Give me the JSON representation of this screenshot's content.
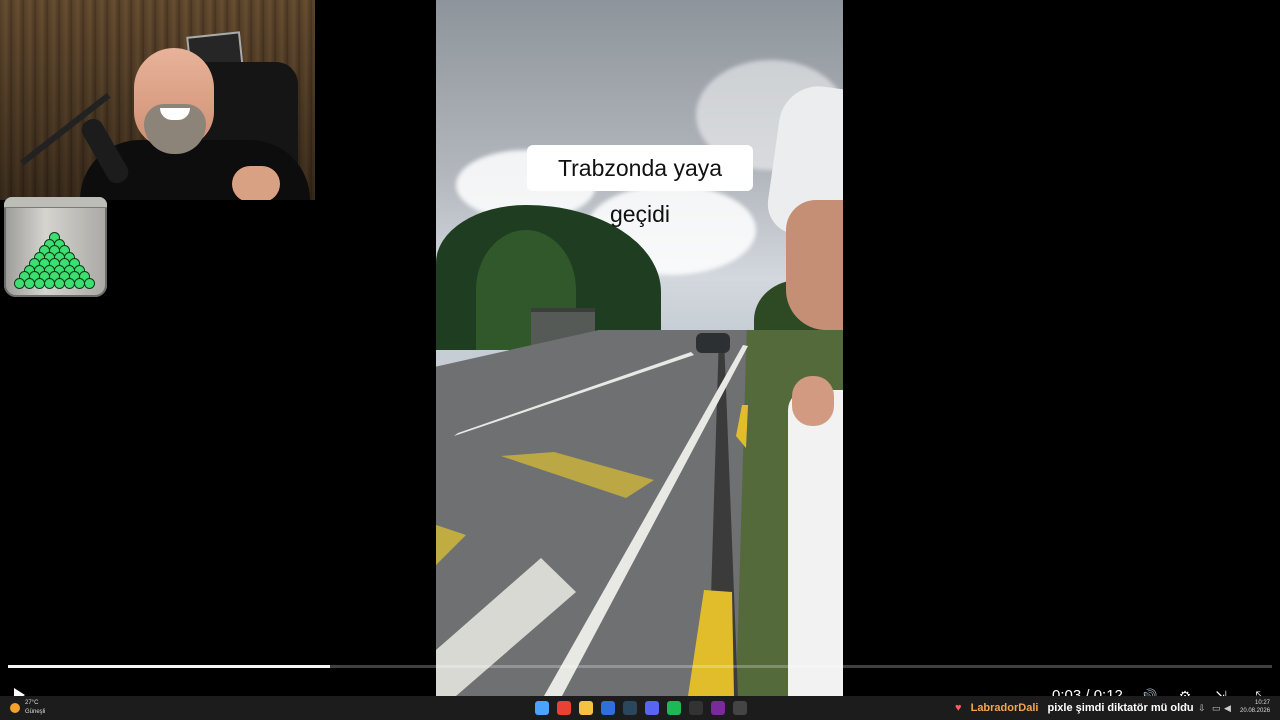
{
  "video": {
    "caption": "Trabzonda yaya geçidi"
  },
  "player": {
    "progress_fraction": 0.255,
    "time_display": "0:03 / 0:12",
    "controls": [
      "play-icon",
      "volume-icon",
      "settings-icon",
      "miniplayer-icon",
      "fullscreen-exit-icon"
    ]
  },
  "taskbar": {
    "weather": {
      "temp": "27°C",
      "condition": "Güneşli",
      "icon": "sun-icon"
    },
    "apps": [
      {
        "name": "windows-start-icon",
        "color": "#4aa3ff"
      },
      {
        "name": "chrome-icon",
        "color": "#e94235"
      },
      {
        "name": "file-explorer-icon",
        "color": "#f5c242"
      },
      {
        "name": "app-icon-blue",
        "color": "#2e6fdc"
      },
      {
        "name": "steam-icon",
        "color": "#2a475e"
      },
      {
        "name": "discord-icon",
        "color": "#5865f2"
      },
      {
        "name": "spotify-icon",
        "color": "#1db954"
      },
      {
        "name": "epic-games-icon",
        "color": "#333333"
      },
      {
        "name": "streaming-app-icon",
        "color": "#7a2a9a"
      },
      {
        "name": "obs-icon",
        "color": "#444444"
      }
    ],
    "ticker": {
      "user": "LabradorDali",
      "message": "pixle şimdi diktatör mü oldu"
    },
    "clock": {
      "time": "10:27",
      "date": "20.08.2026"
    }
  },
  "colors": {
    "accent_user": "#f6a54a",
    "progress": "#f5f5f5"
  }
}
